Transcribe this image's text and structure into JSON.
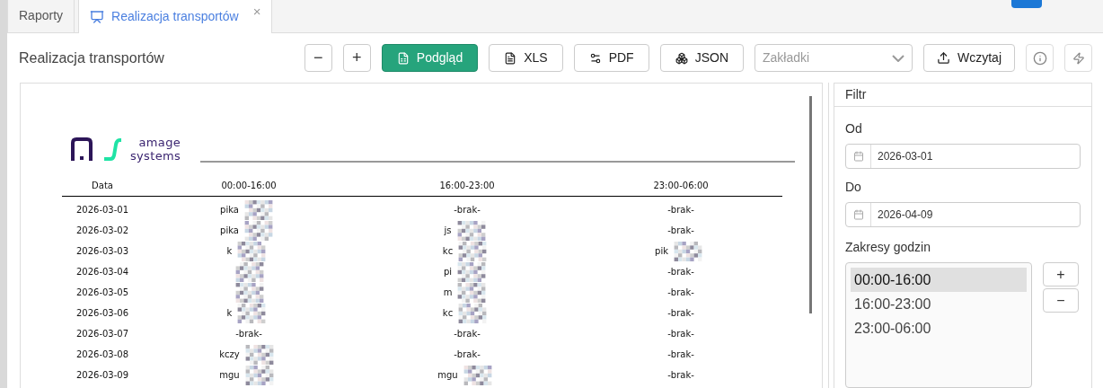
{
  "tabs": [
    {
      "label": "Raporty",
      "selected": false,
      "closable": false
    },
    {
      "label": "Realizacja transportów",
      "selected": true,
      "closable": true,
      "close_icon": "×"
    }
  ],
  "page_title": "Realizacja transportów",
  "toolbar": {
    "zoom_out": "−",
    "zoom_in": "+",
    "buttons": [
      {
        "label": "Podgląd",
        "kind": "primary"
      },
      {
        "label": "XLS",
        "kind": "xls"
      },
      {
        "label": "PDF",
        "kind": "pdf"
      },
      {
        "label": "JSON",
        "kind": "json"
      }
    ],
    "bookmarks_placeholder": "Zakładki",
    "load": "Wczytaj"
  },
  "report": {
    "logo": {
      "line1": "amage",
      "line2": "systems"
    },
    "columns": [
      "Data",
      "00:00-16:00",
      "16:00-23:00",
      "23:00-06:00"
    ],
    "rows": [
      [
        {
          "text": "2026-03-01",
          "redacted": false
        },
        {
          "text": "pika",
          "redacted": true
        },
        {
          "text": "-brak-",
          "redacted": false
        },
        {
          "text": "-brak-",
          "redacted": false
        }
      ],
      [
        {
          "text": "2026-03-02",
          "redacted": false
        },
        {
          "text": "pika",
          "redacted": true
        },
        {
          "text": "js",
          "redacted": true
        },
        {
          "text": "-brak-",
          "redacted": false
        }
      ],
      [
        {
          "text": "2026-03-03",
          "redacted": false
        },
        {
          "text": "k",
          "redacted": true
        },
        {
          "text": "kc",
          "redacted": true
        },
        {
          "text": "pik",
          "redacted": true
        }
      ],
      [
        {
          "text": "2026-03-04",
          "redacted": false
        },
        {
          "text": "",
          "redacted": true
        },
        {
          "text": "pi",
          "redacted": true
        },
        {
          "text": "-brak-",
          "redacted": false
        }
      ],
      [
        {
          "text": "2026-03-05",
          "redacted": false
        },
        {
          "text": "",
          "redacted": true
        },
        {
          "text": "m",
          "redacted": true
        },
        {
          "text": "-brak-",
          "redacted": false
        }
      ],
      [
        {
          "text": "2026-03-06",
          "redacted": false
        },
        {
          "text": "k",
          "redacted": true
        },
        {
          "text": "kc",
          "redacted": true
        },
        {
          "text": "-brak-",
          "redacted": false
        }
      ],
      [
        {
          "text": "2026-03-07",
          "redacted": false
        },
        {
          "text": "-brak-",
          "redacted": false
        },
        {
          "text": "-brak-",
          "redacted": false
        },
        {
          "text": "-brak-",
          "redacted": false
        }
      ],
      [
        {
          "text": "2026-03-08",
          "redacted": false
        },
        {
          "text": "kczy",
          "redacted": true
        },
        {
          "text": "-brak-",
          "redacted": false
        },
        {
          "text": "-brak-",
          "redacted": false
        }
      ],
      [
        {
          "text": "2026-03-09",
          "redacted": false
        },
        {
          "text": "mgu",
          "redacted": true
        },
        {
          "text": "mgu",
          "redacted": true
        },
        {
          "text": "-brak-",
          "redacted": false
        }
      ]
    ]
  },
  "filter": {
    "title": "Filtr",
    "from_label": "Od",
    "from_value": "2026-03-01",
    "to_label": "Do",
    "to_value": "2026-04-09",
    "ranges_label": "Zakresy godzin",
    "ranges": [
      {
        "label": "00:00-16:00",
        "selected": true
      },
      {
        "label": "16:00-23:00",
        "selected": false
      },
      {
        "label": "23:00-06:00",
        "selected": false
      }
    ],
    "add": "+",
    "remove": "−"
  }
}
